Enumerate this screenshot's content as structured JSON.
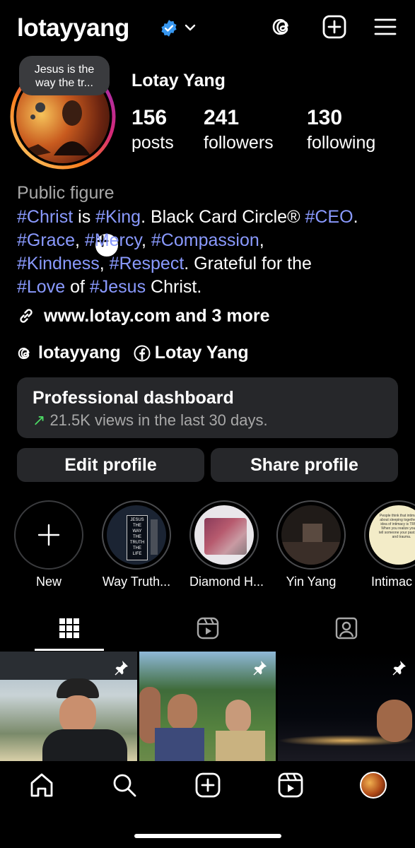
{
  "header": {
    "username": "lotayyang"
  },
  "profile": {
    "note": "Jesus is the way the tr...",
    "display_name": "Lotay Yang",
    "stats": [
      {
        "value": "156",
        "label": "posts"
      },
      {
        "value": "241",
        "label": "followers"
      },
      {
        "value": "130",
        "label": "following"
      }
    ],
    "category": "Public figure",
    "bio": {
      "line1": {
        "t1": "#Christ",
        "t2": " is ",
        "t3": "#King",
        "t4": ". Black Card Circle® ",
        "t5": "#CEO",
        "t6": "."
      },
      "line2": {
        "t1": "#Grace",
        "t2": ", ",
        "t3": "#Mercy",
        "t4": ", ",
        "t5": "#Compassion",
        "t6": ","
      },
      "line3": {
        "t1": "#Kindness",
        "t2": ", ",
        "t3": "#Respect",
        "t4": ". Grateful for the"
      },
      "line4": {
        "t1": "#Love",
        "t2": " of ",
        "t3": "#Jesus",
        "t4": " Christ."
      }
    },
    "link": "www.lotay.com and 3 more",
    "threads_handle": "lotayyang",
    "facebook_name": "Lotay Yang"
  },
  "dashboard": {
    "title": "Professional dashboard",
    "arrow": "↗",
    "subtitle": "21.5K views in the last 30 days."
  },
  "buttons": {
    "edit": "Edit profile",
    "share": "Share profile"
  },
  "highlights": [
    {
      "label": "New"
    },
    {
      "label": "Way Truth...",
      "image_text": [
        "JESUS",
        "THE",
        "WAY",
        "THE",
        "TRUTH",
        "THE",
        "LIFE"
      ]
    },
    {
      "label": "Diamond H..."
    },
    {
      "label": "Yin Yang"
    },
    {
      "label": "Intimac",
      "image_text": "People think that intimacy is about sleeping together. My idea of intimacy is TRUTH. When you realize you can tell someone your past, pain, and trauma."
    }
  ],
  "colors": {
    "accent_link": "#8a9aff",
    "verified": "#3797f0",
    "trend_up": "#4cd964",
    "card_bg": "#26272a"
  }
}
